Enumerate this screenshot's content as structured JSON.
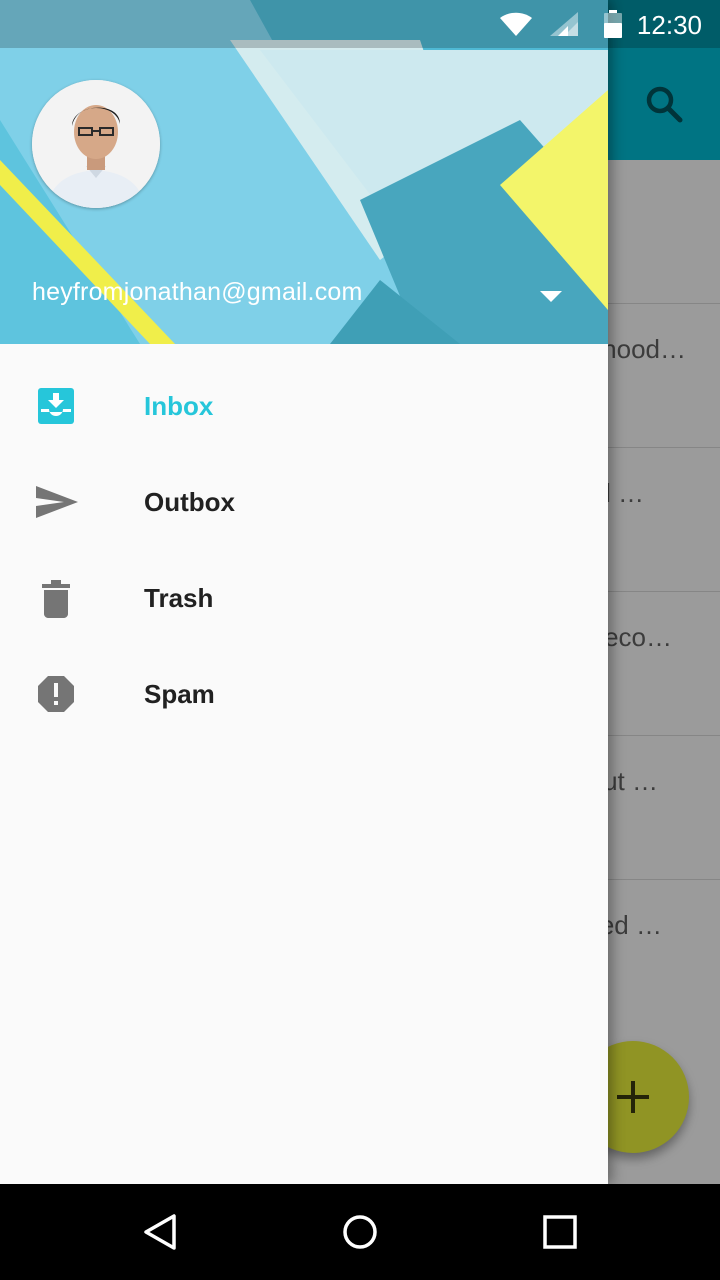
{
  "status_bar": {
    "time": "12:30",
    "icons": [
      "wifi-icon",
      "signal-icon",
      "battery-icon"
    ]
  },
  "background_app": {
    "toolbar_color": "#00bcd4",
    "search_icon": "search-icon",
    "snippets": [
      "hood…",
      "d …",
      "eco…",
      "ut …",
      "ed …"
    ],
    "fab_icon": "plus-icon",
    "fab_color": "#e8ef3a"
  },
  "drawer": {
    "account": {
      "email": "heyfromjonathan@gmail.com",
      "dropdown_icon": "arrow-drop-down-icon"
    },
    "items": [
      {
        "label": "Inbox",
        "icon": "inbox-icon",
        "active": true
      },
      {
        "label": "Outbox",
        "icon": "send-icon",
        "active": false
      },
      {
        "label": "Trash",
        "icon": "trash-icon",
        "active": false
      },
      {
        "label": "Spam",
        "icon": "report-icon",
        "active": false
      }
    ],
    "accent_color": "#26c6da"
  },
  "nav_bar": {
    "buttons": [
      "back-icon",
      "home-icon",
      "recents-icon"
    ]
  }
}
